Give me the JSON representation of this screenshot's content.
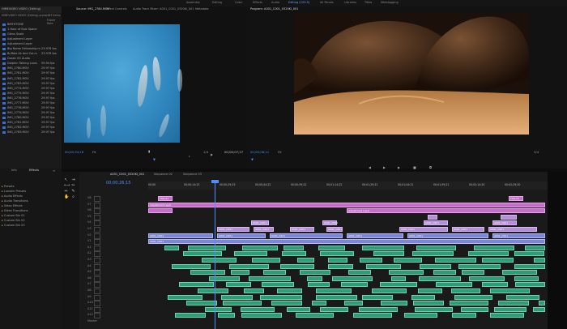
{
  "workspaces": [
    "Assembly",
    "Editing",
    "Color",
    "Effects",
    "Audio",
    "Editing (CS5.5)",
    "All Panels",
    "Libraries",
    "Titles",
    "Metalogging"
  ],
  "project": {
    "title": "HIMEVIDEO VIDEO (Editing)",
    "subtitle": "HIMEVIDEO VIDEO (Editing).prproj",
    "count": "463 Items",
    "col_header": "Frame Rate",
    "items": [
      {
        "name": "BIRTHTONE",
        "fps": ""
      },
      {
        "name": "1 Hour of Epic Space",
        "fps": ""
      },
      {
        "name": "Glens Scale",
        "fps": ""
      },
      {
        "name": "Adjustment Layer",
        "fps": ""
      },
      {
        "name": "Adjustment Layer",
        "fps": ""
      },
      {
        "name": "Big Name Fellowship.m",
        "fps": "23.976 fps"
      },
      {
        "name": "Buffalo 4k And Col.m",
        "fps": "23.976 fps"
      },
      {
        "name": "Dorab VG Audio",
        "fps": ""
      },
      {
        "name": "Dolphin Talking Louis",
        "fps": "59.94 fps"
      },
      {
        "name": "IMG_2780.MOV",
        "fps": "29.97 fps"
      },
      {
        "name": "IMG_2781.MOV",
        "fps": "29.97 fps"
      },
      {
        "name": "IMG_2782.MOV",
        "fps": "29.97 fps"
      },
      {
        "name": "IMG_2783.MOV",
        "fps": "29.97 fps"
      },
      {
        "name": "IMG_2774.MOV",
        "fps": "29.97 fps"
      },
      {
        "name": "IMG_2775.MOV",
        "fps": "29.97 fps"
      },
      {
        "name": "IMG_2776.MOV",
        "fps": "29.97 fps"
      },
      {
        "name": "IMG_2777.MOV",
        "fps": "29.97 fps"
      },
      {
        "name": "IMG_2778.MOV",
        "fps": "29.97 fps"
      },
      {
        "name": "IMG_2779.MOV",
        "fps": "29.97 fps"
      },
      {
        "name": "IMG_2780.MOV",
        "fps": "29.97 fps"
      },
      {
        "name": "IMG_2781.MOV",
        "fps": "29.97 fps"
      },
      {
        "name": "IMG_2782.MOV",
        "fps": "29.97 fps"
      },
      {
        "name": "IMG_2783.MOV",
        "fps": "29.97 fps"
      }
    ]
  },
  "source": {
    "tabs": [
      "Source: IMG_2780.MOV",
      "Effect Controls",
      "Audio Track Mixer: A001_C001_0320KI_001",
      "Metadata"
    ],
    "timecode_in": "00;00;34;16",
    "timecode_out": "00;00;07;27",
    "fit": "Fit",
    "scale": "1/4"
  },
  "program": {
    "tab": "Program: A001_C001_0320KI_001",
    "timecode_in": "00;00;06;11",
    "fit": "Fit",
    "scale": "3/4"
  },
  "effects_panel": {
    "tabs": [
      "Info",
      "Effects"
    ],
    "items": [
      "Presets",
      "Lumetri Presets",
      "Audio Effects",
      "Audio Transitions",
      "Video Effects",
      "Video Transitions",
      "Custom Bin 01",
      "Custom Bin 02",
      "Custom Bin 03"
    ]
  },
  "timeline": {
    "tabs": [
      "A001_C001_0320KI_001",
      "Sequence 02",
      "Sequence 03"
    ],
    "timecode": "00;00;26;15",
    "ruler": [
      "00;00",
      "00;00;14;23",
      "00;00;29;23",
      "00;00;44;22",
      "00;00;59;22",
      "00;01;14;22",
      "00;01;29;21",
      "00;01;44;21",
      "00;01;59;21",
      "00;02;14;20",
      "00;02;29;20"
    ],
    "video_tracks": [
      "V8",
      "V7",
      "V6",
      "V5",
      "V4",
      "V3",
      "V2",
      "V1"
    ],
    "audio_tracks": [
      "A1",
      "A2",
      "A3",
      "A4",
      "A5",
      "A6",
      "A7",
      "A8",
      "A9",
      "A10",
      "A11",
      "A12"
    ],
    "master": "Master",
    "clip_labels": {
      "adjustment": "Adjustment Layer",
      "seq": "A001_C001",
      "title": "Title 01"
    }
  },
  "colors": {
    "accent": "#4c8dff",
    "video_clip": "#b48ed6",
    "adjustment_clip": "#c46ec9",
    "audio_clip": "#2f9b79"
  }
}
